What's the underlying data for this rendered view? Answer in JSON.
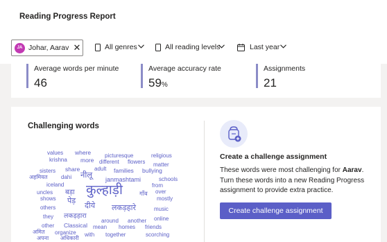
{
  "header": {
    "title": "Reading Progress Report"
  },
  "filters": {
    "student": {
      "initials": "JA",
      "name": "Johar, Aarav",
      "avatar_color": "#c239b3"
    },
    "genres": {
      "label": "All genres",
      "icon": "book-icon"
    },
    "levels": {
      "label": "All reading levels",
      "icon": "book-icon"
    },
    "date": {
      "label": "Last year",
      "icon": "calendar-icon"
    }
  },
  "stats": [
    {
      "label": "Average words per minute",
      "value": "46",
      "unit": ""
    },
    {
      "label": "Average accuracy rate",
      "value": "59",
      "unit": "%"
    },
    {
      "label": "Assignments",
      "value": "21",
      "unit": ""
    }
  ],
  "challenging": {
    "title": "Challenging words",
    "words": [
      "values",
      "where",
      "picturesque",
      "religious",
      "krishna",
      "more",
      "different",
      "flowers",
      "matter",
      "sisters",
      "share",
      "adult",
      "families",
      "bullying",
      "अहमियत",
      "dahi",
      "नीलू",
      "janmashtami",
      "schools",
      "iceland",
      "from",
      "uncles",
      "बड़ा",
      "कुल्हाड़ी",
      "गाँव",
      "over",
      "shows",
      "पेड़",
      "mostly",
      "others",
      "दीये",
      "लकड़हारे",
      "music",
      "they",
      "लकड़हारा",
      "around",
      "another",
      "online",
      "other",
      "Classical",
      "mean",
      "homes",
      "friends",
      "अमित",
      "organize",
      "with",
      "together",
      "scorching",
      "अपना",
      "अधिकारी"
    ]
  },
  "cta": {
    "title": "Create a challenge assignment",
    "desc_prefix": "These words were most challenging for ",
    "student_first": "Aarav",
    "desc_suffix": ". Turn these words into a new Reading Progress assignment to provide extra practice.",
    "button": "Create challenge assignment"
  },
  "colors": {
    "accent": "#5b5fc7",
    "stat_border": "#8b8cc7"
  }
}
